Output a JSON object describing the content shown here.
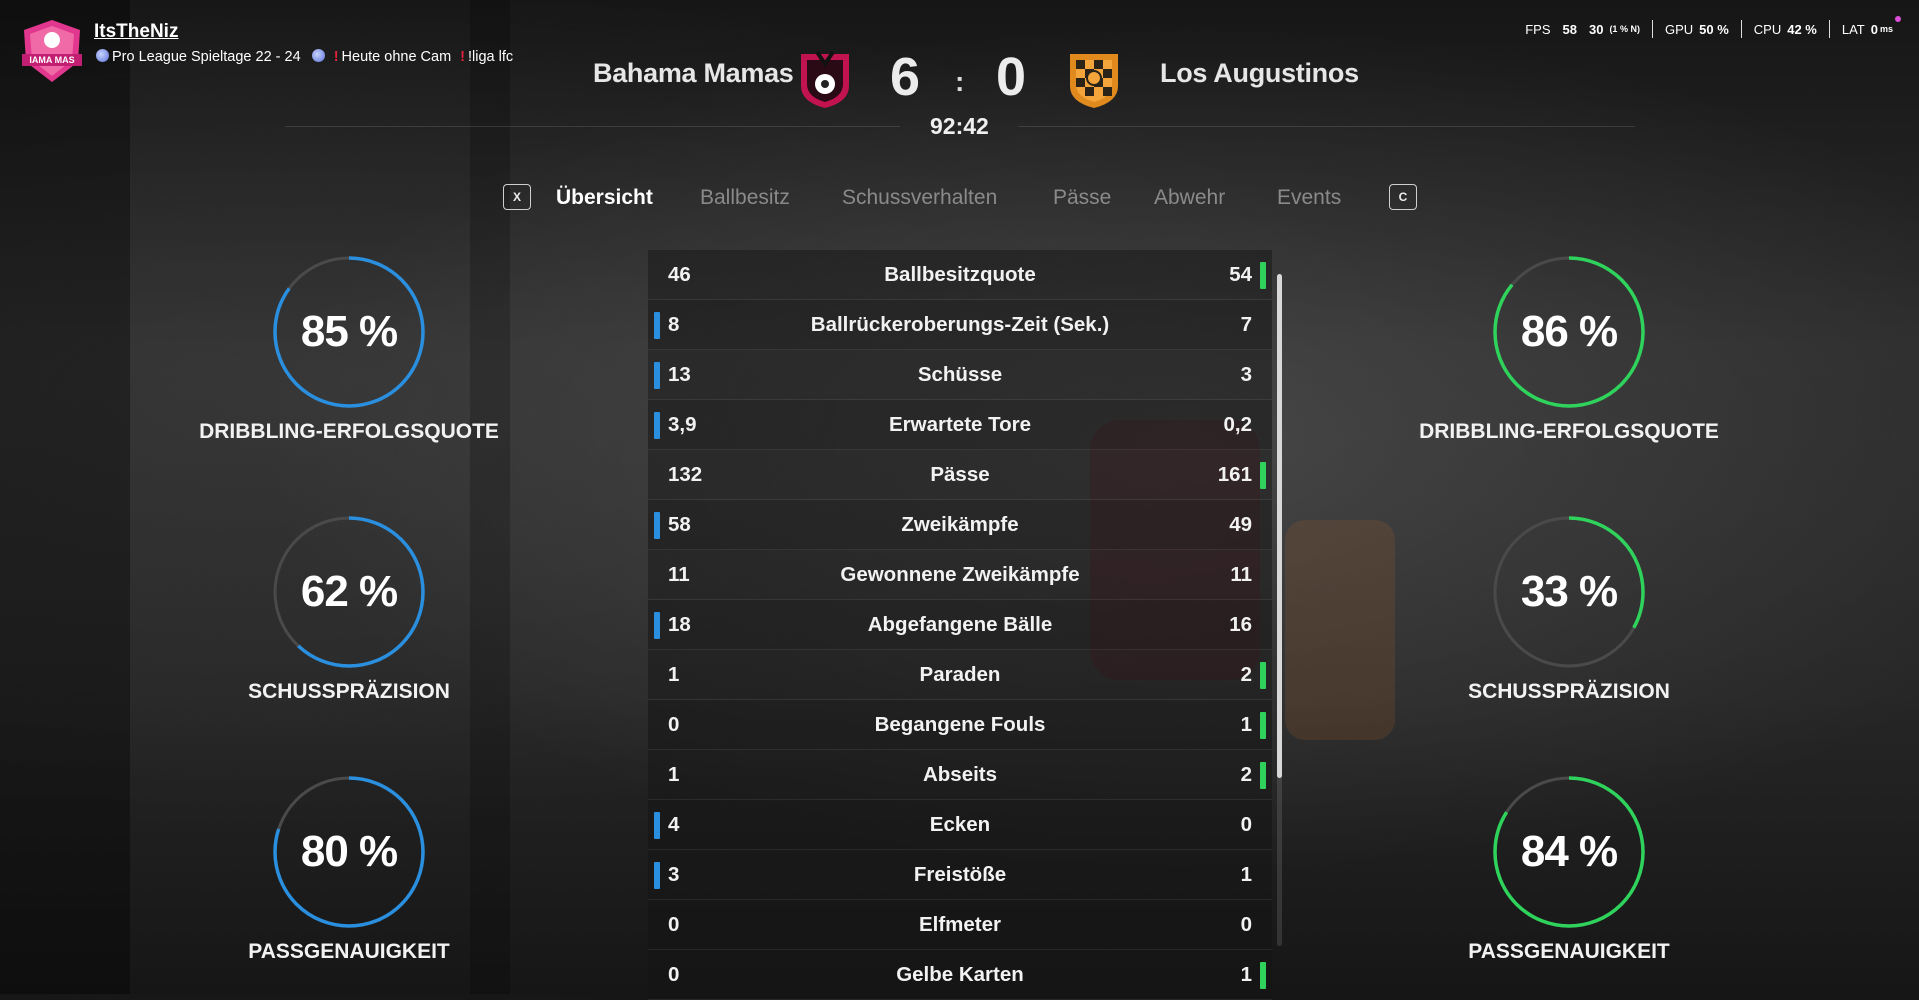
{
  "overlay": {
    "streamer_name": "ItsTheNiz",
    "title_part1": "Pro League Spieltage 22 - 24",
    "title_part2": "Heute ohne Cam",
    "title_part3": "!liga lfc",
    "logo_text": "IAMA MAS",
    "fps_label": "FPS",
    "fps_value": "58",
    "fps_low_value": "30",
    "fps_low_note": "(1 % N)",
    "gpu_label": "GPU",
    "gpu_value": "50 %",
    "cpu_label": "CPU",
    "cpu_value": "42 %",
    "lat_label": "LAT",
    "lat_value": "0",
    "lat_unit": "ms"
  },
  "match": {
    "home_team": "Bahama Mamas",
    "away_team": "Los Augustinos",
    "home_score": "6",
    "separator": ":",
    "away_score": "0",
    "clock": "92:42",
    "colors": {
      "home_crest": "#c0134f",
      "away_crest": "#e08a1e"
    }
  },
  "tabs": {
    "prev_key": "X",
    "next_key": "C",
    "items": [
      "Übersicht",
      "Ballbesitz",
      "Schussverhalten",
      "Pässe",
      "Abwehr",
      "Events"
    ],
    "active_index": 0
  },
  "stats": [
    {
      "label": "Ballbesitzquote",
      "home": "46",
      "away": "54",
      "leader": "away"
    },
    {
      "label": "Ballrückeroberungs-Zeit (Sek.)",
      "home": "8",
      "away": "7",
      "leader": "home"
    },
    {
      "label": "Schüsse",
      "home": "13",
      "away": "3",
      "leader": "home"
    },
    {
      "label": "Erwartete Tore",
      "home": "3,9",
      "away": "0,2",
      "leader": "home"
    },
    {
      "label": "Pässe",
      "home": "132",
      "away": "161",
      "leader": "away"
    },
    {
      "label": "Zweikämpfe",
      "home": "58",
      "away": "49",
      "leader": "home"
    },
    {
      "label": "Gewonnene Zweikämpfe",
      "home": "11",
      "away": "11",
      "leader": "none"
    },
    {
      "label": "Abgefangene Bälle",
      "home": "18",
      "away": "16",
      "leader": "home"
    },
    {
      "label": "Paraden",
      "home": "1",
      "away": "2",
      "leader": "away"
    },
    {
      "label": "Begangene Fouls",
      "home": "0",
      "away": "1",
      "leader": "away"
    },
    {
      "label": "Abseits",
      "home": "1",
      "away": "2",
      "leader": "away"
    },
    {
      "label": "Ecken",
      "home": "4",
      "away": "0",
      "leader": "home"
    },
    {
      "label": "Freistöße",
      "home": "3",
      "away": "1",
      "leader": "home"
    },
    {
      "label": "Elfmeter",
      "home": "0",
      "away": "0",
      "leader": "none"
    },
    {
      "label": "Gelbe Karten",
      "home": "0",
      "away": "1",
      "leader": "away"
    }
  ],
  "home_rings": [
    {
      "label": "DRIBBLING-ERFOLGSQUOTE",
      "value": 85,
      "text": "85 %"
    },
    {
      "label": "SCHUSSPRÄZISION",
      "value": 62,
      "text": "62 %"
    },
    {
      "label": "PASSGENAUIGKEIT",
      "value": 80,
      "text": "80 %"
    }
  ],
  "away_rings": [
    {
      "label": "DRIBBLING-ERFOLGSQUOTE",
      "value": 86,
      "text": "86 %"
    },
    {
      "label": "SCHUSSPRÄZISION",
      "value": 33,
      "text": "33 %"
    },
    {
      "label": "PASSGENAUIGKEIT",
      "value": 84,
      "text": "84 %"
    }
  ],
  "colors": {
    "home_accent": "#2a8fde",
    "away_accent": "#2fd35c"
  }
}
